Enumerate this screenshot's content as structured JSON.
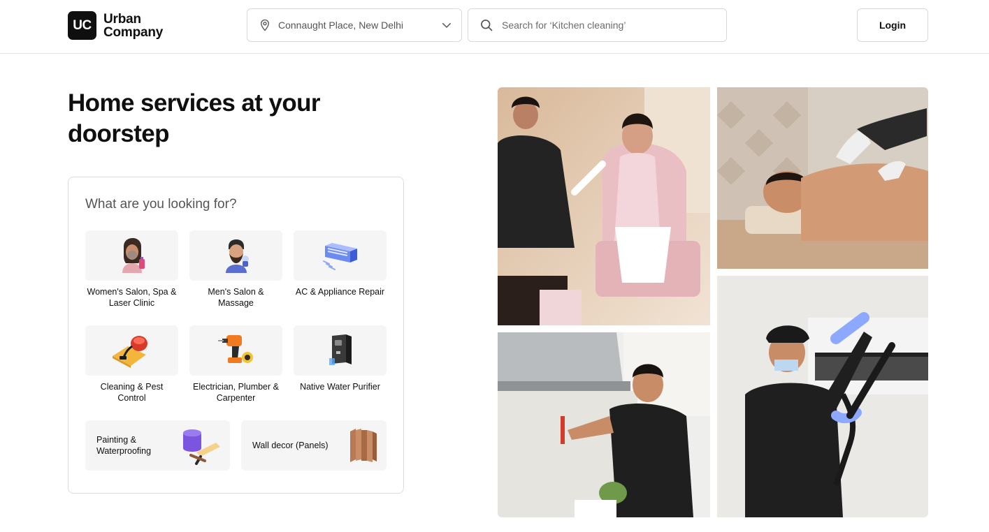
{
  "brand": {
    "logo_mark": "UC",
    "name_line1": "Urban",
    "name_line2": "Company"
  },
  "header": {
    "location": "Connaught Place, New Delhi",
    "search_placeholder": "Search for ‘Kitchen cleaning’",
    "login_label": "Login"
  },
  "hero": {
    "title": "Home services at your doorstep"
  },
  "panel": {
    "title": "What are you looking for?",
    "services": [
      {
        "label": "Women's Salon, Spa & Laser Clinic",
        "icon": "woman-salon-icon"
      },
      {
        "label": "Men's Salon & Massage",
        "icon": "man-salon-icon"
      },
      {
        "label": "AC & Appliance Repair",
        "icon": "ac-unit-icon"
      },
      {
        "label": "Cleaning & Pest Control",
        "icon": "vacuum-cleaner-icon"
      },
      {
        "label": "Electrician, Plumber & Carpenter",
        "icon": "drill-icon"
      },
      {
        "label": "Native Water Purifier",
        "icon": "water-purifier-icon"
      }
    ],
    "wide_services": [
      {
        "label": "Painting & Waterproofing",
        "icon": "paint-roller-icon"
      },
      {
        "label": "Wall decor (Panels)",
        "icon": "wall-panels-icon"
      }
    ]
  },
  "photos": [
    {
      "name": "salon-service-photo"
    },
    {
      "name": "massage-service-photo"
    },
    {
      "name": "kitchen-chimney-service-photo"
    },
    {
      "name": "ac-cleaning-service-photo"
    }
  ],
  "colors": {
    "brand_dark": "#0f0f0f",
    "tile_bg": "#f5f5f5",
    "border": "#d9d9d9"
  }
}
